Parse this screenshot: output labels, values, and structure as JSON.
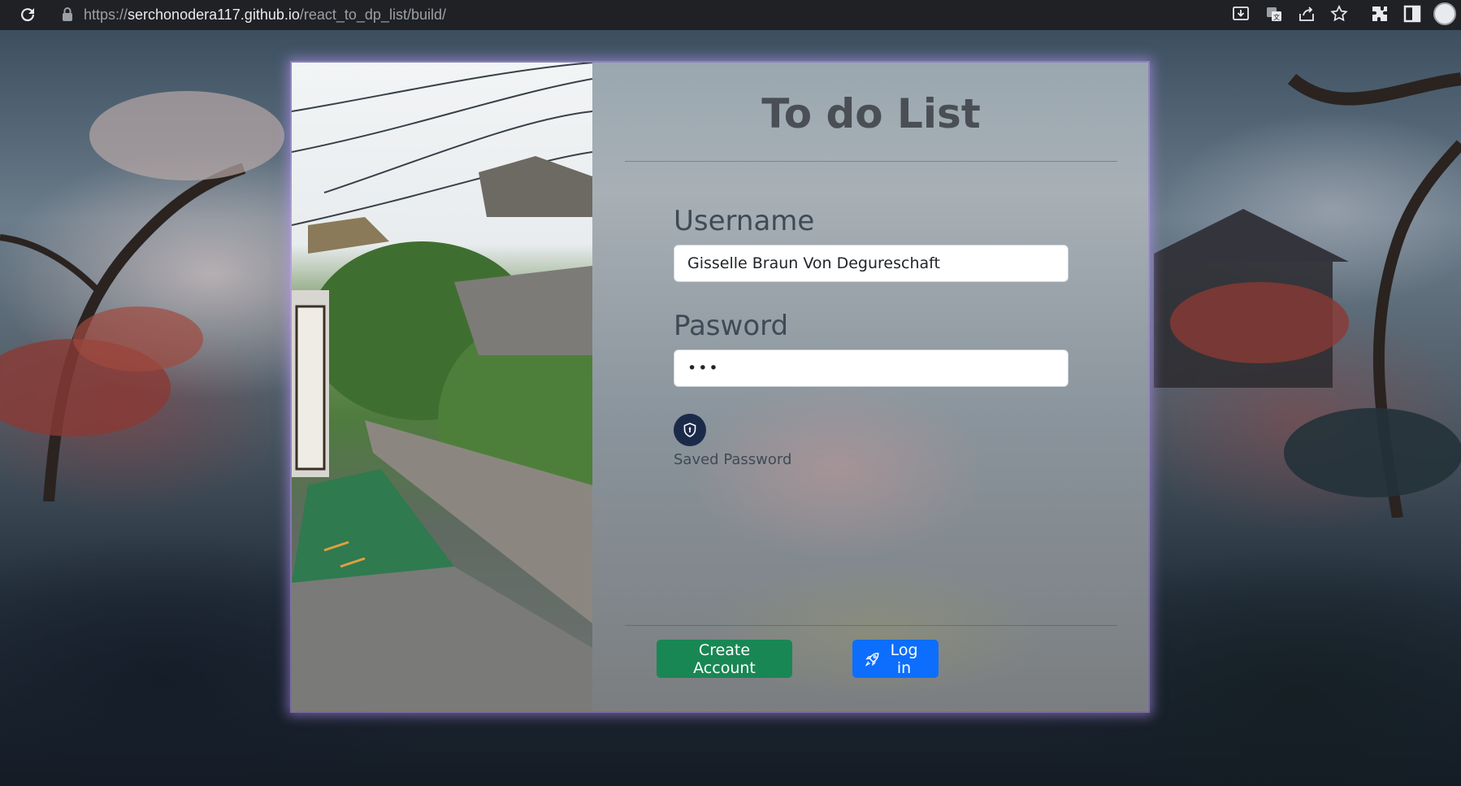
{
  "browser": {
    "url_prefix": "https://",
    "url_host": "serchonodera117.github.io",
    "url_path": "/react_to_dp_list/build/",
    "icons": [
      "reload-icon",
      "lock-icon",
      "install-app-icon",
      "translate-icon",
      "share-icon",
      "bookmark-star-icon",
      "extensions-icon",
      "side-panel-icon",
      "profile-avatar"
    ]
  },
  "login": {
    "title": "To do List",
    "username_label": "Username",
    "username_value": "Gisselle Braun Von Degureschaft",
    "password_label": "Pasword",
    "password_value": "•••",
    "saved_password_icon": "shield-icon",
    "saved_password_label": "Saved Password",
    "create_account_label": "Create Account",
    "login_icon": "rocket-icon",
    "login_label": "Log in"
  },
  "colors": {
    "create_button": "#198754",
    "login_button": "#0d6efd",
    "saved_password_badge": "#1c2a4a",
    "card_glow": "#be96ff"
  }
}
